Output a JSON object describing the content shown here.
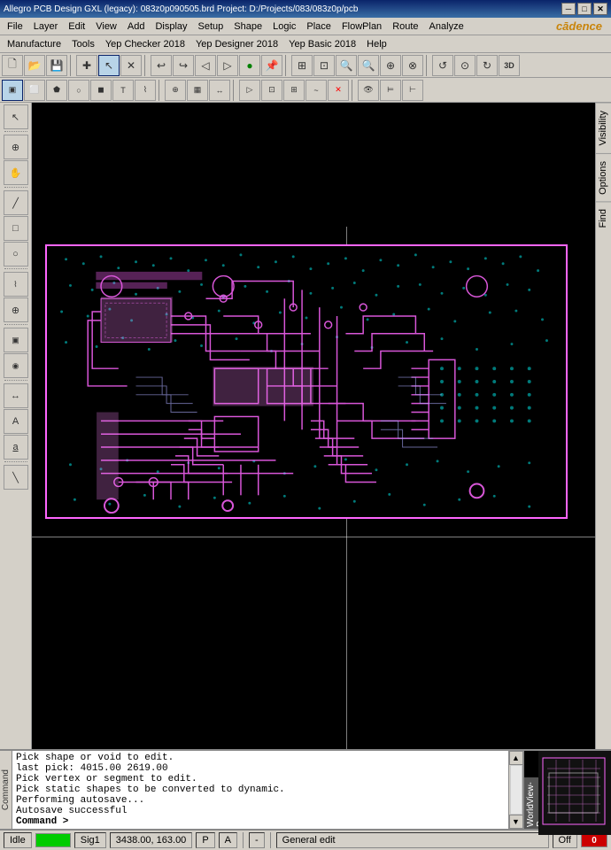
{
  "titleBar": {
    "title": "Allegro PCB Design GXL (legacy): 083z0p090505.brd  Project: D:/Projects/083/083z0p/pcb",
    "minBtn": "─",
    "maxBtn": "□",
    "closeBtn": "✕"
  },
  "menuBar1": {
    "items": [
      "File",
      "Layer",
      "Edit",
      "View",
      "Add",
      "Display",
      "Setup",
      "Shape",
      "Logic",
      "Place",
      "FlowPlan",
      "Route",
      "Analyze"
    ]
  },
  "menuBar2": {
    "items": [
      "Manufacture",
      "Tools",
      "Yep Checker 2018",
      "Yep Designer 2018",
      "Yep Basic 2018",
      "Help"
    ]
  },
  "brandLogo": "cādence",
  "console": {
    "lines": [
      "Pick shape or void to edit.",
      "last pick:  4015.00 2619.00",
      "Pick vertex or segment to edit.",
      "Pick static shapes to be converted to dynamic.",
      "Performing autosave...",
      "Autosave successful",
      "Command >"
    ],
    "label": "Command"
  },
  "statusBar": {
    "mode": "Idle",
    "signal": "Sig1",
    "coords": "3438.00, 163.00",
    "p": "P",
    "a": "A",
    "dash": "-",
    "editMode": "General edit",
    "off": "Off",
    "num": "0"
  },
  "rightPanel": {
    "tabs": [
      "Visibility",
      "Options",
      "Find"
    ]
  },
  "worldView": {
    "label": "WorldView-P"
  }
}
